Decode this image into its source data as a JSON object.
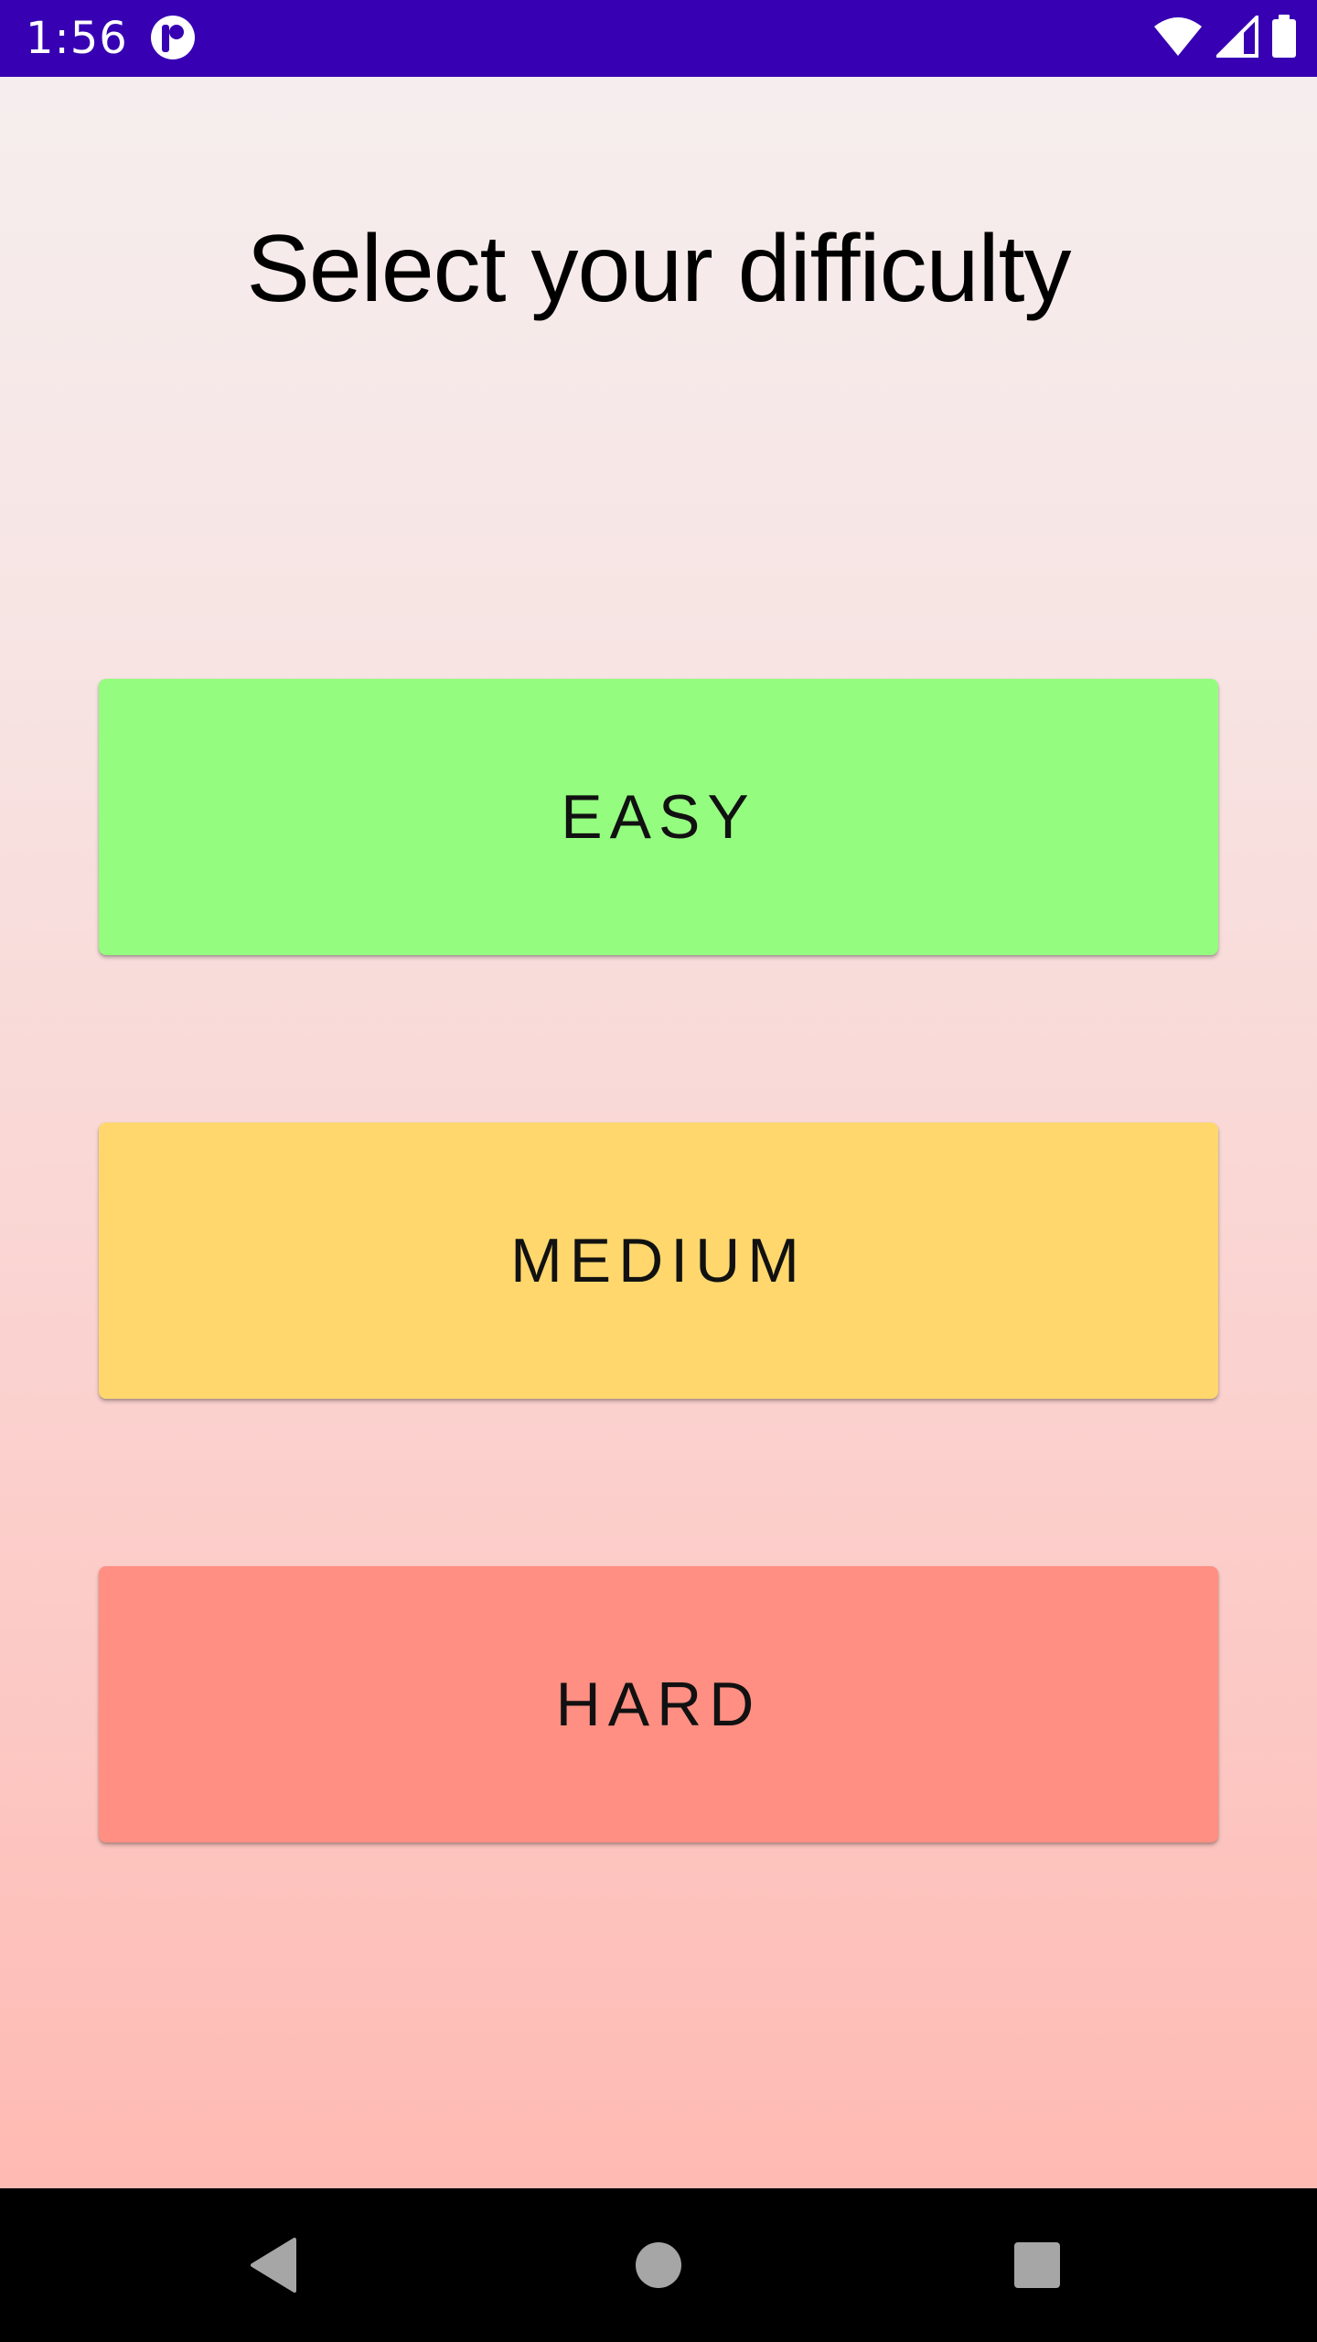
{
  "status_bar": {
    "time": "1:56",
    "background_color": "#3700b3",
    "icons": [
      "app-notification-icon",
      "wifi-icon",
      "cell-signal-icon",
      "battery-icon"
    ]
  },
  "screen": {
    "title": "Select your difficulty"
  },
  "difficulty_buttons": [
    {
      "label": "EASY",
      "color": "#94fd7f"
    },
    {
      "label": "MEDIUM",
      "color": "#ffd76d"
    },
    {
      "label": "HARD",
      "color": "#ff8f82"
    }
  ],
  "nav_bar": {
    "icons": [
      "back-icon",
      "home-icon",
      "recent-apps-icon"
    ]
  }
}
